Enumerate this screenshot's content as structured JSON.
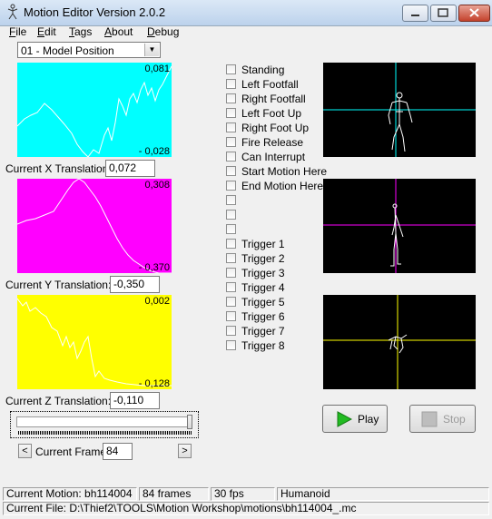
{
  "window": {
    "title": "Motion Editor Version 2.0.2"
  },
  "menu": [
    "File",
    "Edit",
    "Tags",
    "About",
    "Debug"
  ],
  "channel_select": {
    "value": "01 - Model Position"
  },
  "graphs": {
    "x": {
      "max": "0,081",
      "min": "- 0,028",
      "color": "#00ffff"
    },
    "y": {
      "max": "0,308",
      "min": "- 0,370",
      "color": "#ff00ff"
    },
    "z": {
      "max": "0,002",
      "min": "- 0,128",
      "color": "#ffff00"
    }
  },
  "fields": {
    "x_label": "Current X Translation:",
    "x_value": "0,072",
    "y_label": "Current Y Translation:",
    "y_value": "-0,350",
    "z_label": "Current Z Translation:",
    "z_value": "-0,110",
    "frame_label": "Current Frame:",
    "frame_value": "84"
  },
  "flags": [
    "Standing",
    "Left Footfall",
    "Right Footfall",
    "Left Foot Up",
    "Right Foot Up",
    "Fire Release",
    "Can Interrupt",
    "Start Motion Here",
    "End Motion Here",
    "",
    "",
    "",
    "Trigger 1",
    "Trigger 2",
    "Trigger 3",
    "Trigger 4",
    "Trigger 5",
    "Trigger 6",
    "Trigger 7",
    "Trigger 8"
  ],
  "buttons": {
    "play": "Play",
    "stop": "Stop"
  },
  "status": {
    "motion": "Current Motion: bh114004",
    "frames": "84 frames",
    "fps": "30 fps",
    "type": "Humanoid",
    "file": "Current File: D:\\Thief2\\TOOLS\\Motion Workshop\\motions\\bh114004_.mc"
  },
  "colors": {
    "x_axis": "#00ffff",
    "y_axis": "#ff00ff",
    "z_axis": "#ffff00",
    "play_icon": "#22bb22"
  }
}
